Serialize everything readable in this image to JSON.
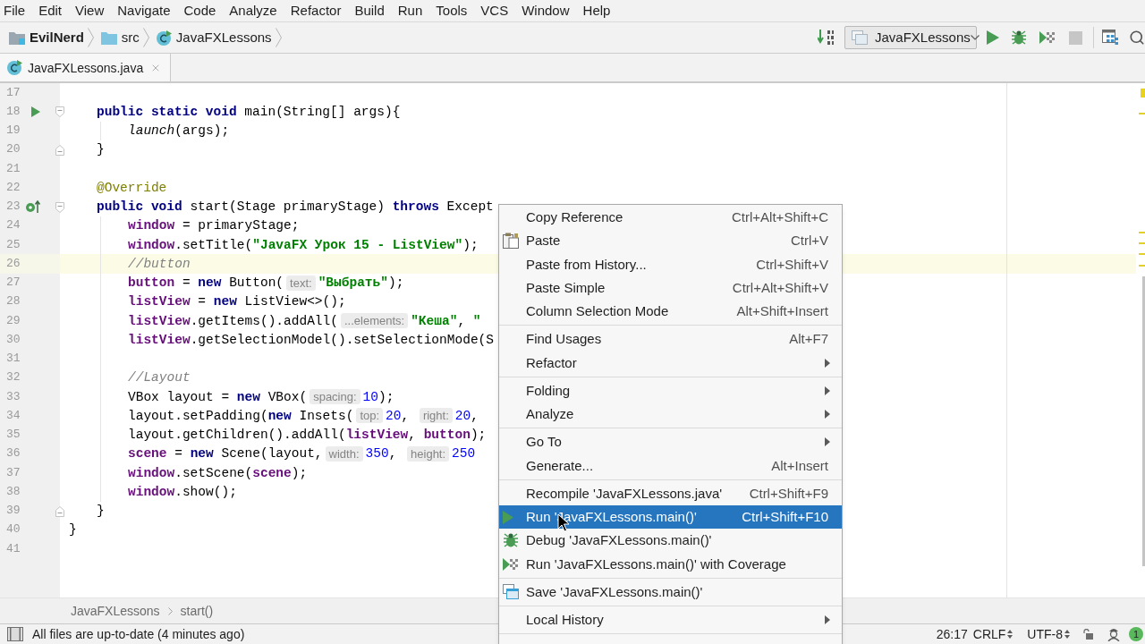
{
  "menu_bar": [
    {
      "label": "File"
    },
    {
      "label": "Edit"
    },
    {
      "label": "View"
    },
    {
      "label": "Navigate"
    },
    {
      "label": "Code"
    },
    {
      "label": "Analyze"
    },
    {
      "label": "Refactor"
    },
    {
      "label": "Build"
    },
    {
      "label": "Run"
    },
    {
      "label": "Tools"
    },
    {
      "label": "VCS"
    },
    {
      "label": "Window"
    },
    {
      "label": "Help"
    }
  ],
  "navigation_bar": {
    "breadcrumbs": [
      {
        "kind": "module",
        "label": "EvilNerd"
      },
      {
        "kind": "folder",
        "label": "src"
      },
      {
        "kind": "class",
        "label": "JavaFXLessons"
      }
    ],
    "run_configuration": "JavaFXLessons",
    "toolbar_buttons": [
      {
        "kind": "run",
        "disabled": false
      },
      {
        "kind": "debug",
        "disabled": false
      },
      {
        "kind": "coverage",
        "disabled": false
      },
      {
        "kind": "stop",
        "disabled": true
      }
    ]
  },
  "editor_tabs": [
    {
      "label": "JavaFXLessons.java",
      "selected": true
    }
  ],
  "editor": {
    "class_body": [
      {
        "number": "17",
        "current": false
      },
      {
        "number": "18",
        "current": false,
        "gutter_icon": {
          "kind": "run"
        },
        "fold_marker": {
          "kind": "start"
        },
        "tokens": [
          {
            "kind": "keyword",
            "text": "public static void"
          },
          {
            "kind": "plain",
            "text": " main(String[] args){"
          }
        ],
        "children": [
          {
            "number": "19",
            "current": false,
            "tokens": [
              {
                "kind": "static_call",
                "text": "launch"
              },
              {
                "kind": "plain",
                "text": "(args);"
              }
            ]
          }
        ]
      },
      {
        "number": "20",
        "current": false,
        "fold_marker": {
          "kind": "end"
        },
        "tokens": [
          {
            "kind": "plain",
            "text": "}"
          }
        ]
      },
      {
        "number": "21",
        "current": false
      },
      {
        "number": "22",
        "current": false,
        "tokens": [
          {
            "kind": "annotation",
            "text": "@Override"
          }
        ]
      },
      {
        "number": "23",
        "current": false,
        "gutter_icon": {
          "kind": "override"
        },
        "fold_marker": {
          "kind": "start"
        },
        "tokens": [
          {
            "kind": "keyword",
            "text": "public void"
          },
          {
            "kind": "plain",
            "text": " start(Stage primaryStage) "
          },
          {
            "kind": "keyword",
            "text": "throws"
          },
          {
            "kind": "plain",
            "text": " Except"
          }
        ],
        "children": [
          {
            "number": "24",
            "current": false,
            "tokens": [
              {
                "kind": "field",
                "text": "window"
              },
              {
                "kind": "plain",
                "text": " = primaryStage;"
              }
            ]
          },
          {
            "number": "25",
            "current": false,
            "tokens": [
              {
                "kind": "field",
                "text": "window"
              },
              {
                "kind": "plain",
                "text": ".setTitle("
              },
              {
                "kind": "string",
                "text": "\"JavaFX Урок 15 - ListView\""
              },
              {
                "kind": "plain",
                "text": ");"
              }
            ]
          },
          {
            "number": "26",
            "current": true,
            "tokens": [
              {
                "kind": "comment",
                "text": "//button"
              }
            ]
          },
          {
            "number": "27",
            "current": false,
            "tokens": [
              {
                "kind": "field",
                "text": "button"
              },
              {
                "kind": "plain",
                "text": " = "
              },
              {
                "kind": "keyword",
                "text": "new"
              },
              {
                "kind": "plain",
                "text": " Button("
              },
              {
                "kind": "hint",
                "text": "text:"
              },
              {
                "kind": "string",
                "text": "\"Выбрать\""
              },
              {
                "kind": "plain",
                "text": ");"
              }
            ]
          },
          {
            "number": "28",
            "current": false,
            "tokens": [
              {
                "kind": "field",
                "text": "listView"
              },
              {
                "kind": "plain",
                "text": " = "
              },
              {
                "kind": "keyword",
                "text": "new"
              },
              {
                "kind": "plain",
                "text": " ListView<>();"
              }
            ]
          },
          {
            "number": "29",
            "current": false,
            "tokens": [
              {
                "kind": "field",
                "text": "listView"
              },
              {
                "kind": "plain",
                "text": ".getItems().addAll("
              },
              {
                "kind": "hint",
                "text": "...elements:"
              },
              {
                "kind": "string",
                "text": "\"Кеша\""
              },
              {
                "kind": "plain",
                "text": ", "
              },
              {
                "kind": "string",
                "text": "\""
              }
            ]
          },
          {
            "number": "30",
            "current": false,
            "tokens": [
              {
                "kind": "field",
                "text": "listView"
              },
              {
                "kind": "plain",
                "text": ".getSelectionModel().setSelectionMode(S"
              }
            ]
          },
          {
            "number": "31",
            "current": false
          },
          {
            "number": "32",
            "current": false,
            "tokens": [
              {
                "kind": "comment",
                "text": "//Layout"
              }
            ]
          },
          {
            "number": "33",
            "current": false,
            "tokens": [
              {
                "kind": "plain",
                "text": "VBox layout = "
              },
              {
                "kind": "keyword",
                "text": "new"
              },
              {
                "kind": "plain",
                "text": " VBox("
              },
              {
                "kind": "hint",
                "text": "spacing:"
              },
              {
                "kind": "number",
                "text": "10"
              },
              {
                "kind": "plain",
                "text": ");"
              }
            ]
          },
          {
            "number": "34",
            "current": false,
            "tokens": [
              {
                "kind": "plain",
                "text": "layout.setPadding("
              },
              {
                "kind": "keyword",
                "text": "new"
              },
              {
                "kind": "plain",
                "text": " Insets("
              },
              {
                "kind": "hint",
                "text": "top:"
              },
              {
                "kind": "number",
                "text": "20"
              },
              {
                "kind": "plain",
                "text": ", "
              },
              {
                "kind": "hint",
                "text": "right:"
              },
              {
                "kind": "number",
                "text": "20"
              },
              {
                "kind": "plain",
                "text": ","
              }
            ]
          },
          {
            "number": "35",
            "current": false,
            "tokens": [
              {
                "kind": "plain",
                "text": "layout.getChildren().addAll("
              },
              {
                "kind": "field",
                "text": "listView"
              },
              {
                "kind": "plain",
                "text": ", "
              },
              {
                "kind": "field",
                "text": "button"
              },
              {
                "kind": "plain",
                "text": ");"
              }
            ]
          },
          {
            "number": "36",
            "current": false,
            "tokens": [
              {
                "kind": "field",
                "text": "scene"
              },
              {
                "kind": "plain",
                "text": " = "
              },
              {
                "kind": "keyword",
                "text": "new"
              },
              {
                "kind": "plain",
                "text": " Scene(layout,"
              },
              {
                "kind": "hint",
                "text": "width:"
              },
              {
                "kind": "number",
                "text": "350"
              },
              {
                "kind": "plain",
                "text": ", "
              },
              {
                "kind": "hint",
                "text": "height:"
              },
              {
                "kind": "number",
                "text": "250"
              }
            ]
          },
          {
            "number": "37",
            "current": false,
            "tokens": [
              {
                "kind": "field",
                "text": "window"
              },
              {
                "kind": "plain",
                "text": ".setScene("
              },
              {
                "kind": "field",
                "text": "scene"
              },
              {
                "kind": "plain",
                "text": ");"
              }
            ]
          },
          {
            "number": "38",
            "current": false,
            "tokens": [
              {
                "kind": "field",
                "text": "window"
              },
              {
                "kind": "plain",
                "text": ".show();"
              }
            ]
          }
        ]
      },
      {
        "number": "39",
        "current": false,
        "fold_marker": {
          "kind": "end"
        },
        "tokens": [
          {
            "kind": "plain",
            "text": "}"
          }
        ]
      }
    ],
    "after_class": [
      {
        "number": "40",
        "current": false,
        "tokens": [
          {
            "kind": "plain",
            "text": "}"
          }
        ]
      },
      {
        "number": "41",
        "current": false
      }
    ]
  },
  "context_menu": {
    "groups": [
      [
        {
          "kind": "text",
          "label": "Copy Reference",
          "shortcut": "Ctrl+Alt+Shift+C",
          "has_submenu": false,
          "selected": false
        },
        {
          "kind": "paste",
          "label": "Paste",
          "shortcut": "Ctrl+V",
          "has_submenu": false,
          "selected": false
        },
        {
          "kind": "text",
          "label": "Paste from History...",
          "shortcut": "Ctrl+Shift+V",
          "has_submenu": false,
          "selected": false
        },
        {
          "kind": "text",
          "label": "Paste Simple",
          "shortcut": "Ctrl+Alt+Shift+V",
          "has_submenu": false,
          "selected": false
        },
        {
          "kind": "text",
          "label": "Column Selection Mode",
          "shortcut": "Alt+Shift+Insert",
          "has_submenu": false,
          "selected": false
        }
      ],
      [
        {
          "kind": "text",
          "label": "Find Usages",
          "shortcut": "Alt+F7",
          "has_submenu": false,
          "selected": false
        },
        {
          "kind": "text",
          "label": "Refactor",
          "has_submenu": true,
          "selected": false
        }
      ],
      [
        {
          "kind": "text",
          "label": "Folding",
          "has_submenu": true,
          "selected": false
        },
        {
          "kind": "text",
          "label": "Analyze",
          "has_submenu": true,
          "selected": false
        }
      ],
      [
        {
          "kind": "text",
          "label": "Go To",
          "has_submenu": true,
          "selected": false
        },
        {
          "kind": "text",
          "label": "Generate...",
          "shortcut": "Alt+Insert",
          "has_submenu": false,
          "selected": false
        }
      ],
      [
        {
          "kind": "text",
          "label": "Recompile 'JavaFXLessons.java'",
          "shortcut": "Ctrl+Shift+F9",
          "has_submenu": false,
          "selected": false
        },
        {
          "kind": "run",
          "label": "Run 'JavaFXLessons.main()'",
          "shortcut": "Ctrl+Shift+F10",
          "has_submenu": false,
          "selected": true
        },
        {
          "kind": "debug",
          "label": "Debug 'JavaFXLessons.main()'",
          "has_submenu": false,
          "selected": false
        },
        {
          "kind": "coverage",
          "label": "Run 'JavaFXLessons.main()' with Coverage",
          "has_submenu": false,
          "selected": false
        }
      ],
      [
        {
          "kind": "save",
          "label": "Save 'JavaFXLessons.main()'",
          "has_submenu": false,
          "selected": false
        }
      ],
      [
        {
          "kind": "text",
          "label": "Local History",
          "has_submenu": true,
          "selected": false
        }
      ]
    ]
  },
  "editor_breadcrumbs": [
    "JavaFXLessons",
    "start()"
  ],
  "status_bar": {
    "message": "All files are up-to-date (4 minutes ago)",
    "caret_position": "26:17",
    "line_separator": "CRLF",
    "encoding": "UTF-8",
    "event_badge": "1"
  }
}
